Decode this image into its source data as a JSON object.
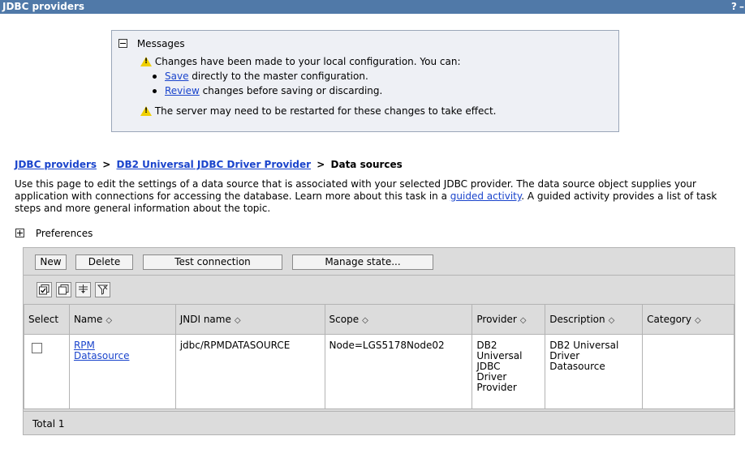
{
  "title_bar": {
    "title": "JDBC providers",
    "help": "?",
    "minimize": "–"
  },
  "messages": {
    "header": "Messages",
    "changes_notice": "Changes have been made to your local configuration. You can:",
    "save_link": "Save",
    "save_rest": " directly to the master configuration.",
    "review_link": "Review",
    "review_rest": " changes before saving or discarding.",
    "restart_notice": "The server may need to be restarted for these changes to take effect."
  },
  "breadcrumb": {
    "item1": "JDBC providers",
    "item2": "DB2 Universal JDBC Driver Provider",
    "current": "Data sources",
    "separator": ">"
  },
  "description": {
    "text1": "Use this page to edit the settings of a data source that is associated with your selected JDBC provider. The data source object supplies your application with connections for accessing the database. Learn more about this task in a ",
    "link": "guided activity",
    "text2": ". A guided activity provides a list of task steps and more general information about the topic."
  },
  "preferences": {
    "label": "Preferences"
  },
  "buttons": {
    "new": "New",
    "delete": "Delete",
    "test_connection": "Test connection",
    "manage_state": "Manage state..."
  },
  "icon_buttons": [
    "select-all-icon",
    "deselect-all-icon",
    "show-filter-icon",
    "clear-filter-icon"
  ],
  "table": {
    "headers": {
      "select": "Select",
      "name": "Name",
      "jndi": "JNDI name",
      "scope": "Scope",
      "provider": "Provider",
      "description": "Description",
      "category": "Category"
    },
    "sort_glyph": "◇",
    "rows": [
      {
        "name_line1": "RPM",
        "name_line2": "Datasource",
        "jndi": "jdbc/RPMDATASOURCE",
        "scope": "Node=LGS5178Node02",
        "provider": [
          "DB2",
          "Universal",
          "JDBC",
          "Driver",
          "Provider"
        ],
        "description": [
          "DB2 Universal",
          "Driver",
          "Datasource"
        ],
        "category": ""
      }
    ],
    "total": "Total 1"
  },
  "colors": {
    "title_bar": "#5079a8",
    "link": "#1a44cc",
    "panel": "#dcdcdc",
    "messages_bg": "#eef0f5",
    "warning": "#f0d000"
  }
}
